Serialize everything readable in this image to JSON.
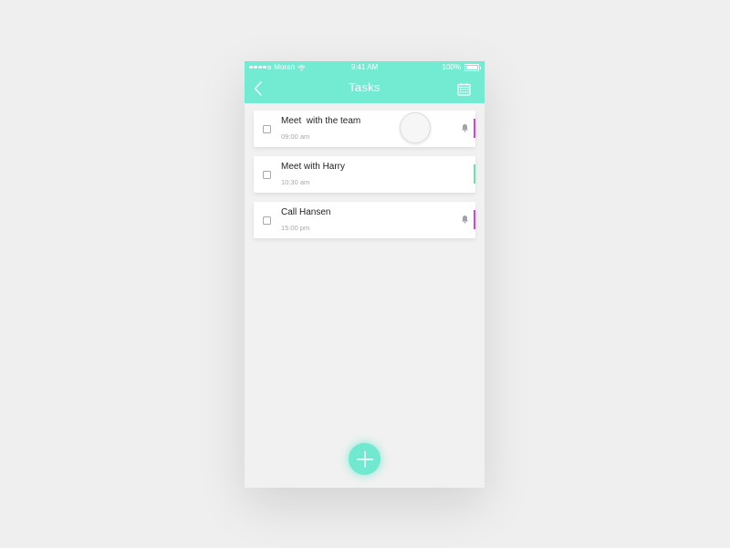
{
  "colors": {
    "accent": "#73ead2",
    "tag_purple": "#c24ecb",
    "tag_green": "#6fe0b0"
  },
  "statusbar": {
    "carrier": "Moran",
    "time": "9:41 AM",
    "battery": "100%",
    "battery_level": 1.0
  },
  "header": {
    "title": "Tasks",
    "back_icon": "chevron-left-icon",
    "calendar_icon": "calendar-icon"
  },
  "tasks": [
    {
      "title": "Meet  with the team",
      "time": "09:00 am",
      "has_reminder": true,
      "tag_color": "#c24ecb"
    },
    {
      "title": "Meet with Harry",
      "time": "10:30 am",
      "has_reminder": false,
      "tag_color": "#6fe0b0"
    },
    {
      "title": "Call Hansen",
      "time": "15:00 pm",
      "has_reminder": true,
      "tag_color": "#c24ecb"
    }
  ],
  "fab": {
    "icon": "plus-icon"
  }
}
